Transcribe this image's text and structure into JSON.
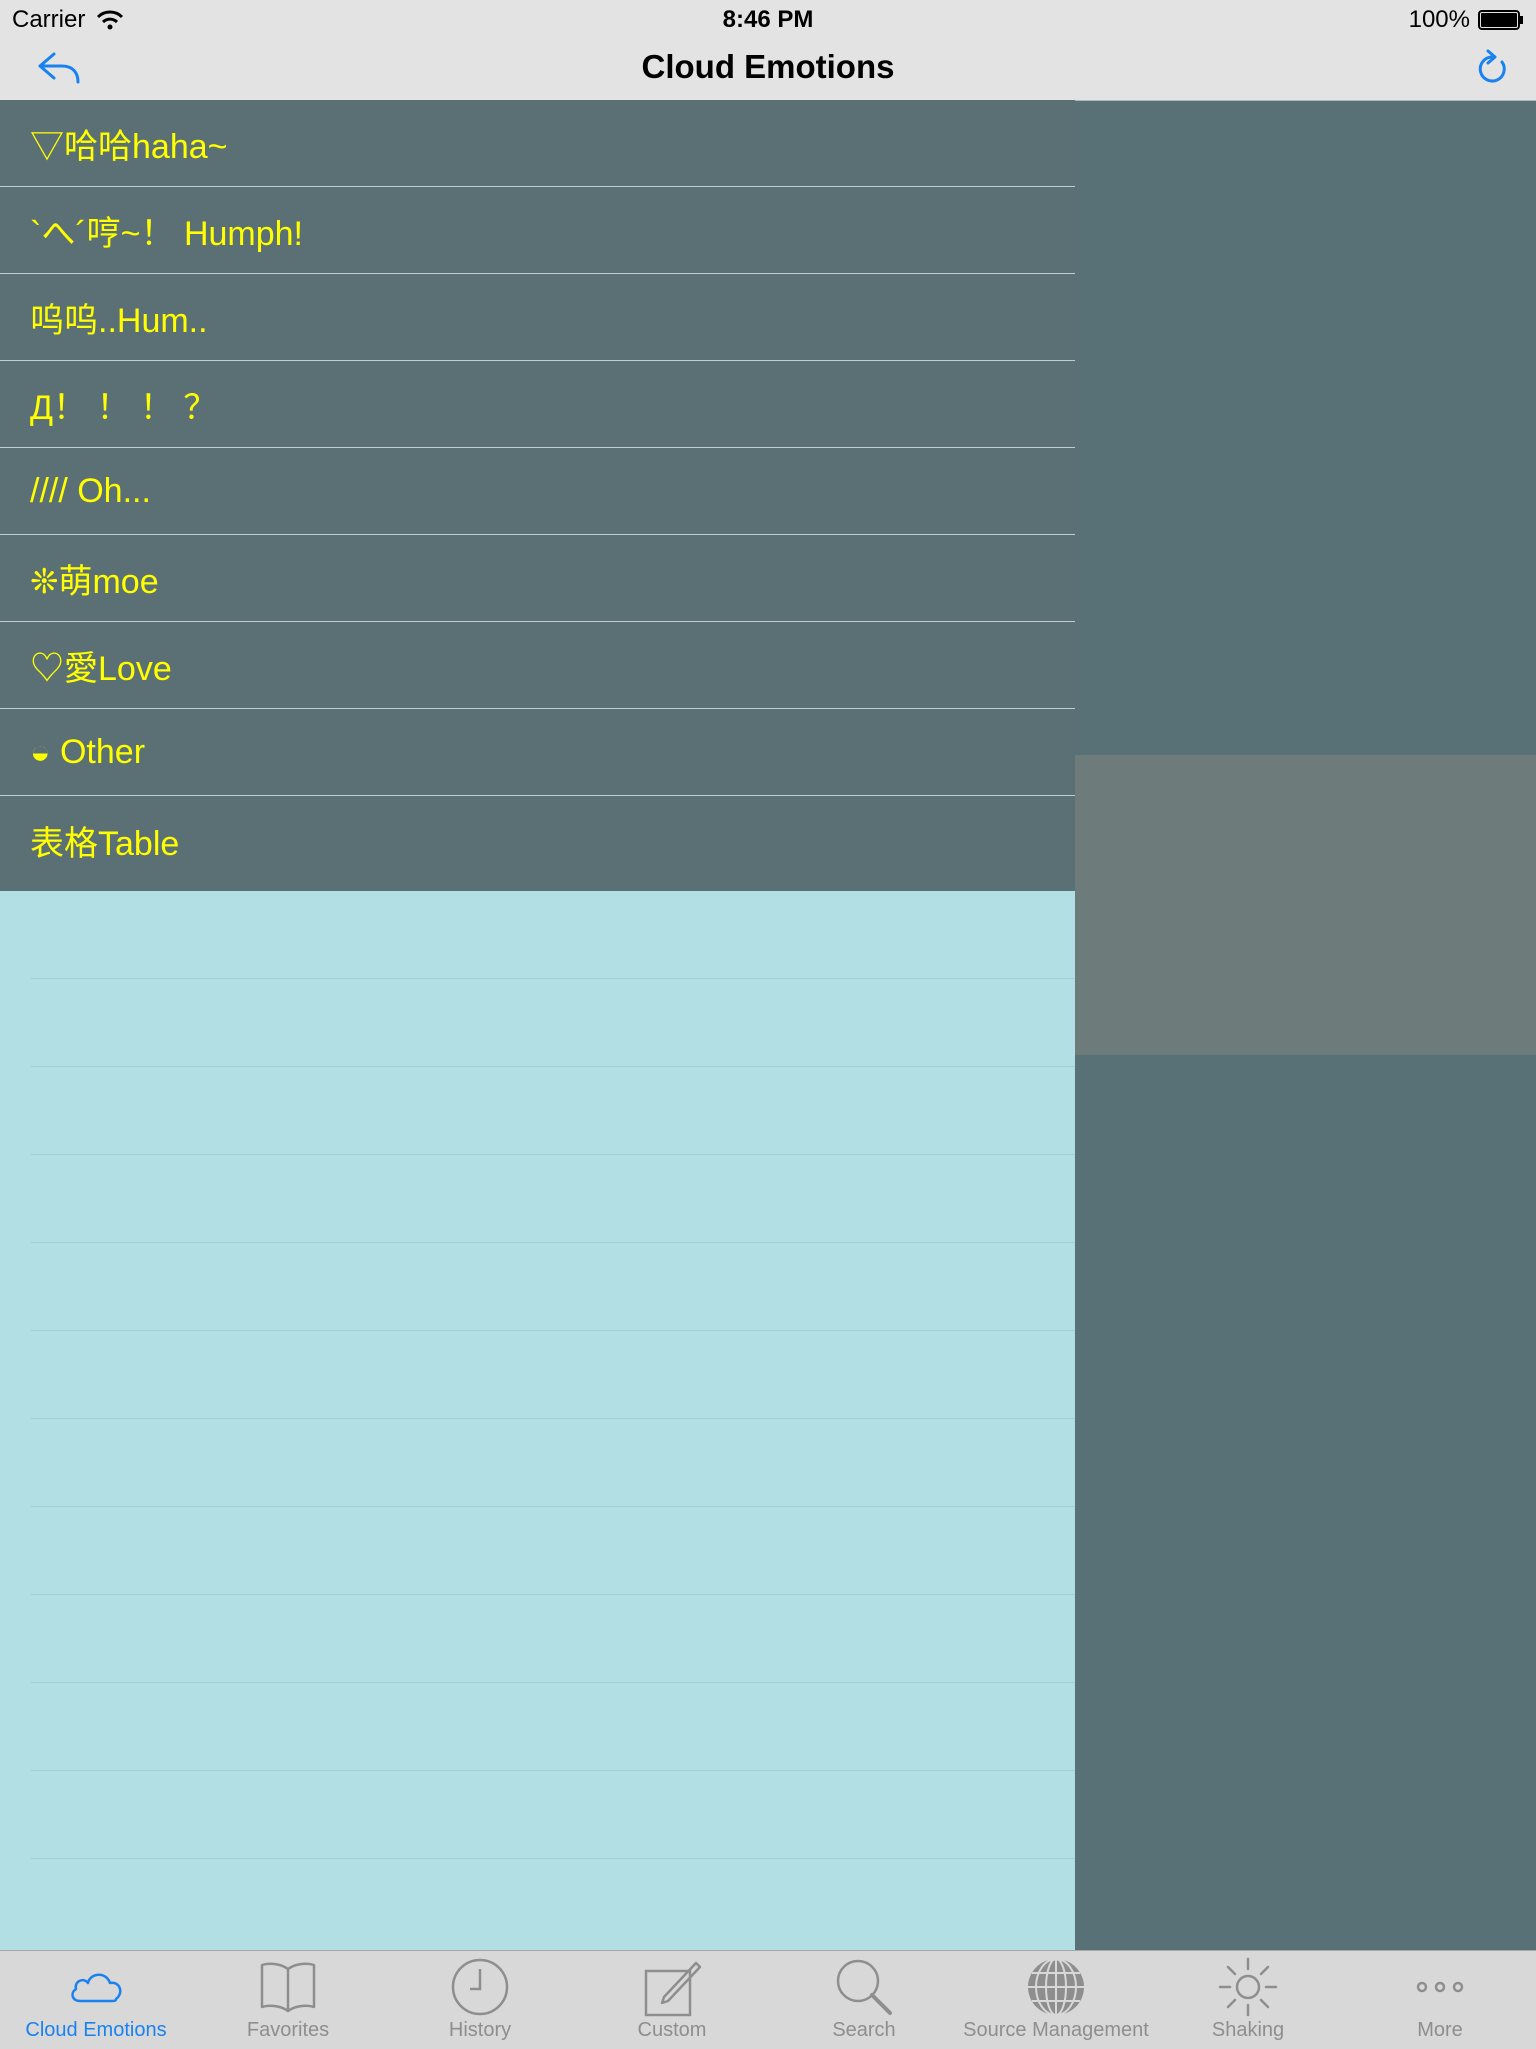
{
  "status_bar": {
    "carrier": "Carrier",
    "time": "8:46 PM",
    "battery": "100%"
  },
  "nav": {
    "title": "Cloud Emotions",
    "back_icon": "back-arrow-icon",
    "refresh_icon": "refresh-icon",
    "accent_color": "#1a82f0"
  },
  "list": {
    "text_color": "#ffff00",
    "items": [
      {
        "label": "▽哈哈haha~"
      },
      {
        "label": "`へ´哼~！ Humph!"
      },
      {
        "label": "呜呜..Hum.."
      },
      {
        "label": "Д！ ！ ！ ？"
      },
      {
        "label": "//// Oh..."
      },
      {
        "label": "❊萌moe"
      },
      {
        "label": "♡愛Love"
      },
      {
        "label": "◒ Other"
      },
      {
        "label": "表格Table"
      }
    ]
  },
  "tab_bar": {
    "tabs": [
      {
        "label": "Cloud Emotions",
        "icon": "cloud-icon",
        "active": true
      },
      {
        "label": "Favorites",
        "icon": "book-icon",
        "active": false
      },
      {
        "label": "History",
        "icon": "clock-icon",
        "active": false
      },
      {
        "label": "Custom",
        "icon": "edit-icon",
        "active": false
      },
      {
        "label": "Search",
        "icon": "search-icon",
        "active": false
      },
      {
        "label": "Source Management",
        "icon": "globe-icon",
        "active": false
      },
      {
        "label": "Shaking",
        "icon": "sun-icon",
        "active": false
      },
      {
        "label": "More",
        "icon": "more-icon",
        "active": false
      }
    ]
  }
}
